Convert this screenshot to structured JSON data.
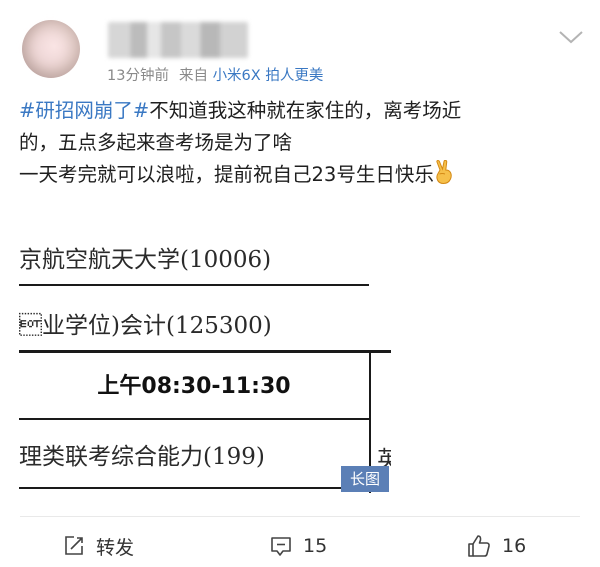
{
  "post": {
    "author": {
      "name": "⬛⬛⬛⬛",
      "avatar_icon": "avatar-icon"
    },
    "meta": {
      "time": "13分钟前",
      "source_prefix": "来自",
      "device": "小米6X",
      "device_suffix": "拍人更美"
    },
    "text": {
      "hashtag": "#研招网崩了#",
      "line1_rest": "不知道我这种就在家住的，离考场近",
      "line2": "的，五点多起来查考场是为了啥",
      "line3": "一天考完就可以浪啦，提前祝自己23号生日快乐"
    },
    "attachment": {
      "row1": "京航空航天大学(10006)",
      "row2": "\u0004业学位)会计(125300)",
      "time": "上午08:30-11:30",
      "subject": "理类联考综合能力(199)",
      "right_char": "英",
      "badge": "长图"
    }
  },
  "actions": {
    "repost_label": "转发",
    "comment_count": "15",
    "like_count": "16"
  },
  "colors": {
    "link_blue": "#3a78c3",
    "meta_gray": "#8a8a8a",
    "badge_blue": "#5b7fb6"
  }
}
